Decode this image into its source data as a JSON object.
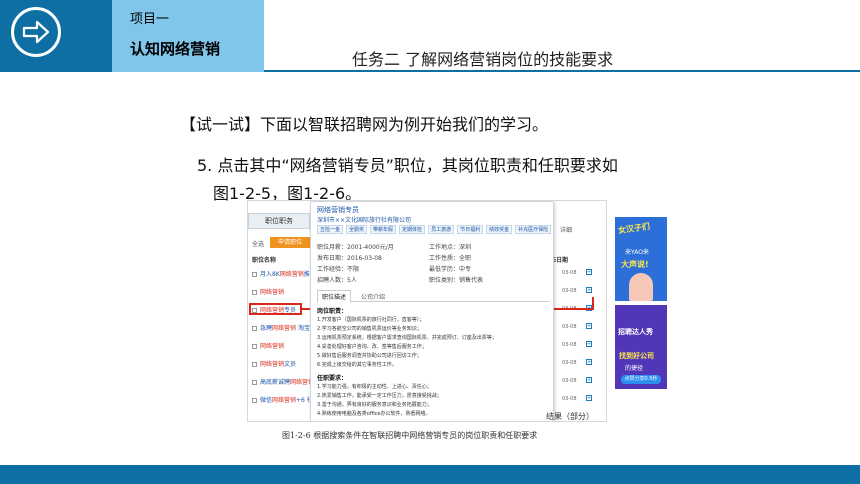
{
  "header": {
    "project": "项目一",
    "topic": "认知网络营销",
    "task": "任务二  了解网络营销岗位的技能要求"
  },
  "body": {
    "try_text": "【试一试】下面以智联招聘网为例开始我们的学习。",
    "step_line1": "5. 点击其中“网络营销专员”职位，其岗位职责和任职要求如",
    "step_line2": "图1-2-5，图1-2-6。"
  },
  "screenshot": {
    "tab_label": "职位职务",
    "select_all": "全选",
    "apply_button": "申请职位",
    "col_job": "职位名称",
    "col_pub": "发布日期",
    "top_right": "详细",
    "jobs": [
      {
        "prefix": "月入8K",
        "highlight": "网络营销",
        "suffix": "推广主"
      },
      {
        "prefix": "",
        "highlight": "网络营销",
        "suffix": ""
      },
      {
        "prefix": "",
        "highlight": "网络营销",
        "suffix": "专员"
      },
      {
        "prefix": "急聘",
        "highlight": "网络营销",
        "suffix": " 淘宝"
      },
      {
        "prefix": "",
        "highlight": "网络营销",
        "suffix": ""
      },
      {
        "prefix": "",
        "highlight": "网络营销",
        "suffix": "文员"
      },
      {
        "prefix": "高底薪诚聘",
        "highlight": "网络营销",
        "suffix": ""
      },
      {
        "prefix": "微信",
        "highlight": "网络营销",
        "suffix": "+6 社区"
      }
    ],
    "dates": [
      "03-08",
      "03-08",
      "03-08",
      "03-08",
      "03-08",
      "03-08",
      "03-08",
      "03-08"
    ],
    "panel": {
      "title": "网络营销专员",
      "company": "深圳市××文化国际旅行社有限公司",
      "tags": [
        "五险一金",
        "全勤奖",
        "带薪年假",
        "定期体检",
        "员工旅游",
        "节日福利",
        "绩效奖金",
        "补充医疗保险"
      ],
      "info_left": [
        "职位月薪：2001-4000元/月",
        "发布日期：2016-03-08",
        "工作经验：不限",
        "招聘人数：5人"
      ],
      "info_right": [
        "工作地点：深圳",
        "工作性质：全职",
        "最低学历：中专",
        "职位类别：销售代表"
      ],
      "tab_desc": "职位描述",
      "tab_company": "公司介绍",
      "duty_title": "岗位职责：",
      "duties": [
        "1.开发客户（国际机票的旅行社同行，直客等）；",
        "2.学习各航空公司的销售机票运价等业务知识；",
        "3.运用机票预定系统，根据客户需求查询国际机票、并完成预订、订座及出票等；",
        "4.妥善处理好客户咨询、改、签等售后服务工作；",
        "5.做好售后服务调查并协助公司进行回访工作；",
        "6.完成上级交给的其它事务性工作。"
      ],
      "req_title": "任职要求：",
      "requirements": [
        "1.学习能力强，有积极的主动性、上进心、责任心；",
        "2.热爱销售工作，能承受一定工作压力，愿意接受挑战；",
        "3.善于沟通，弄有良好的服务意识和业务拓展能力；",
        "4.熟练使用电脑及各类office办公软件，熟悉网络。"
      ]
    }
  },
  "ads": {
    "ad1_title": "女汉子们",
    "ad1_sub": "来YAO来",
    "ad1_big": "大声说!",
    "ad2_title": "招聘达人秀",
    "ad2_main": "找到好公司",
    "ad2_sub": "的捷径",
    "ad2_btn": "点赞分享0.5秒"
  },
  "captions": {
    "partial": "结果（部分）",
    "main": "图1-2-6 根据搜索条件在智联招聘中网络营销专员的岗位职责和任职要求"
  },
  "colors": {
    "brand_blue": "#0d6fa3",
    "light_blue": "#7fc6ea",
    "highlight_red": "#d9281b"
  }
}
